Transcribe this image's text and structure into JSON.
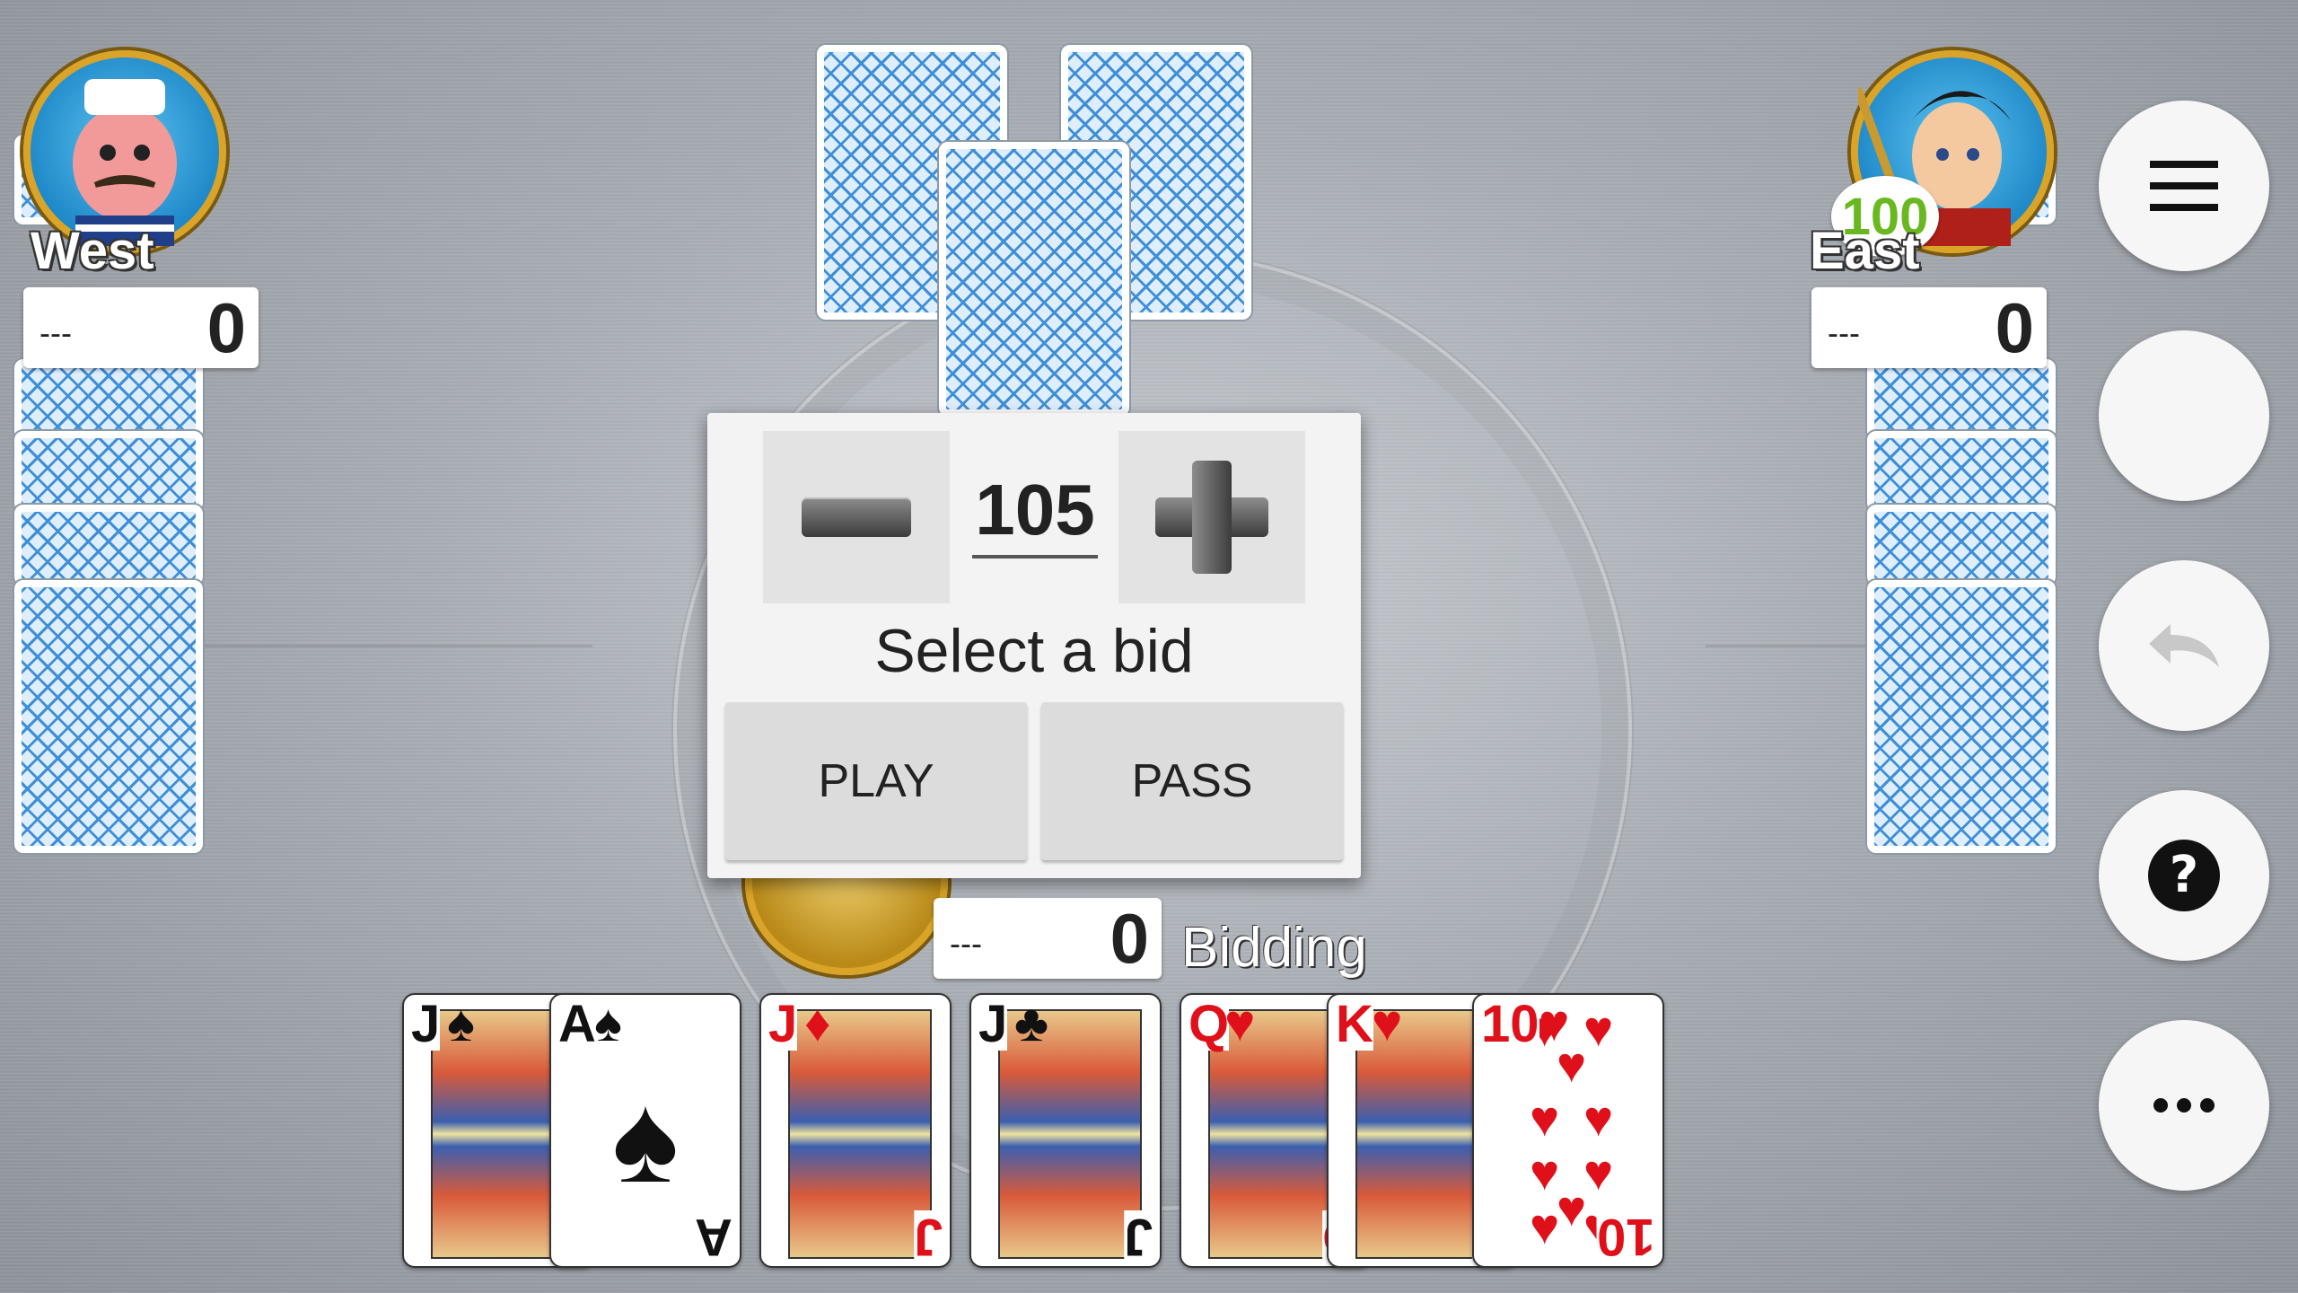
{
  "players": {
    "west": {
      "name": "West",
      "bid": "---",
      "score": "0"
    },
    "east": {
      "name": "East",
      "bid": "---",
      "score": "0",
      "badge": "100"
    },
    "south": {
      "bid": "---",
      "score": "0",
      "status": "Bidding"
    }
  },
  "bid_dialog": {
    "value": "105",
    "prompt": "Select a bid",
    "play_label": "PLAY",
    "pass_label": "PASS"
  },
  "side_buttons": [
    "menu-icon",
    "blank",
    "undo-icon",
    "help-icon",
    "more-icon"
  ],
  "hand": [
    {
      "rank": "J",
      "suit": "♠",
      "color": "black",
      "face": true
    },
    {
      "rank": "A",
      "suit": "♠",
      "color": "black",
      "face": false
    },
    {
      "rank": "J",
      "suit": "♦",
      "color": "red",
      "face": true
    },
    {
      "rank": "J",
      "suit": "♣",
      "color": "black",
      "face": true
    },
    {
      "rank": "Q",
      "suit": "♥",
      "color": "red",
      "face": true
    },
    {
      "rank": "K",
      "suit": "♥",
      "color": "red",
      "face": true
    },
    {
      "rank": "10",
      "suit": "♥",
      "color": "red",
      "face": false
    }
  ],
  "colors": {
    "table": "#a9aeb5",
    "card_back": "#3f8fd8",
    "badge": "#6ab820"
  }
}
